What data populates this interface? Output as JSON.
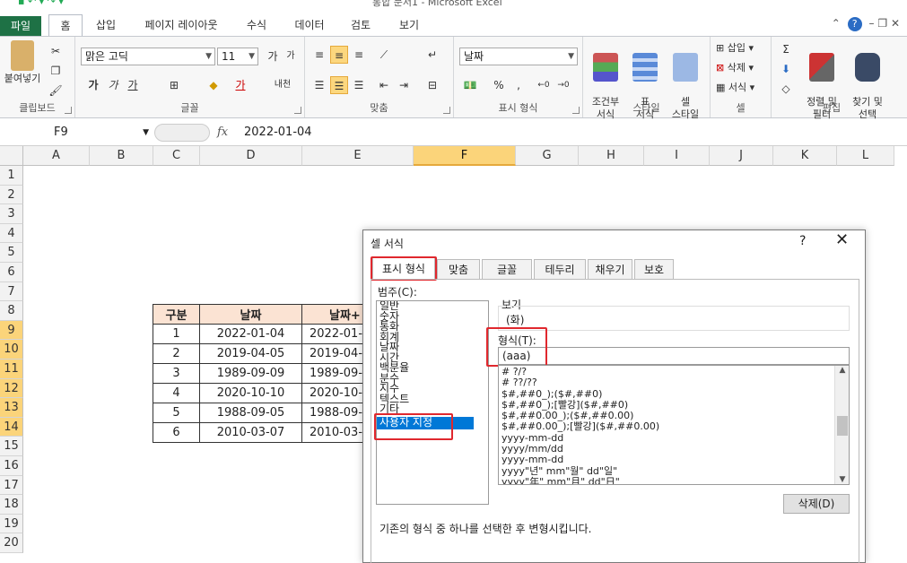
{
  "window": {
    "title": "통합 문서1 - Microsoft Excel"
  },
  "ribbon_tabs": [
    "파일",
    "홈",
    "삽입",
    "페이지 레이아웃",
    "수식",
    "데이터",
    "검토",
    "보기"
  ],
  "ribbon": {
    "clipboard": {
      "paste": "붙여넣기",
      "label": "클립보드"
    },
    "font": {
      "name": "맑은 고딕",
      "size": "11",
      "grow": "가",
      "shrink": "가",
      "bold": "가",
      "italic": "가",
      "underline": "가",
      "color_a": "가",
      "phonetic": "내천",
      "label": "글꼴"
    },
    "alignment": {
      "label": "맞춤"
    },
    "number": {
      "format": "날짜",
      "percent": "%",
      "label": "표시 형식"
    },
    "styles": {
      "conditional": "조건부\n서식",
      "table": "표\n서식",
      "cell": "셀\n스타일",
      "label": "스타일"
    },
    "cells": {
      "insert": "삽입",
      "delete": "삭제",
      "format": "서식",
      "label": "셀"
    },
    "editing": {
      "sort": "정렬 및\n필터",
      "find": "찾기 및\n선택",
      "label": "편집"
    }
  },
  "formula_bar": {
    "name_box": "F9",
    "fx": "fx",
    "value": "2022-01-04"
  },
  "columns": [
    "A",
    "B",
    "C",
    "D",
    "E",
    "F",
    "G",
    "H",
    "I",
    "J",
    "K",
    "L"
  ],
  "selected_column": "F",
  "rows": [
    "1",
    "2",
    "3",
    "4",
    "5",
    "6",
    "7",
    "8",
    "9",
    "10",
    "11",
    "12",
    "13",
    "14",
    "15",
    "16",
    "17",
    "18",
    "19",
    "20"
  ],
  "selected_rows": [
    "9",
    "10",
    "11",
    "12",
    "13",
    "14"
  ],
  "table": {
    "headers": [
      "구분",
      "날짜",
      "날짜+"
    ],
    "rows": [
      [
        "1",
        "2022-01-04",
        "2022-01-"
      ],
      [
        "2",
        "2019-04-05",
        "2019-04-"
      ],
      [
        "3",
        "1989-09-09",
        "1989-09-"
      ],
      [
        "4",
        "2020-10-10",
        "2020-10-"
      ],
      [
        "5",
        "1988-09-05",
        "1988-09-"
      ],
      [
        "6",
        "2010-03-07",
        "2010-03-"
      ]
    ]
  },
  "dialog": {
    "title": "셀 서식",
    "help": "?",
    "close": "✕",
    "tabs": [
      "표시 형식",
      "맞춤",
      "글꼴",
      "테두리",
      "채우기",
      "보호"
    ],
    "category_label": "범주(C):",
    "categories": [
      "일반",
      "숫자",
      "통화",
      "회계",
      "날짜",
      "시간",
      "백분율",
      "분수",
      "지수",
      "텍스트",
      "기타",
      "사용자 지정"
    ],
    "selected_category": "사용자 지정",
    "preview_label": "보기",
    "preview_value": "(화)",
    "type_label": "형식(T):",
    "type_value": "(aaa)",
    "formats": [
      "# ?/?",
      "# ??/??",
      "$#,##0_);($#,##0)",
      "$#,##0_);[빨강]($#,##0)",
      "$#,##0.00_);($#,##0.00)",
      "$#,##0.00_);[빨강]($#,##0.00)",
      "yyyy-mm-dd",
      "yyyy/mm/dd",
      "yyyy-mm-dd",
      "yyyy\"년\" mm\"월\" dd\"일\"",
      "yyyy\"年\" mm\"月\" dd\"日\""
    ],
    "delete_button": "삭제(D)",
    "description": "기존의 형식 중 하나를 선택한 후 변형시킵니다."
  }
}
